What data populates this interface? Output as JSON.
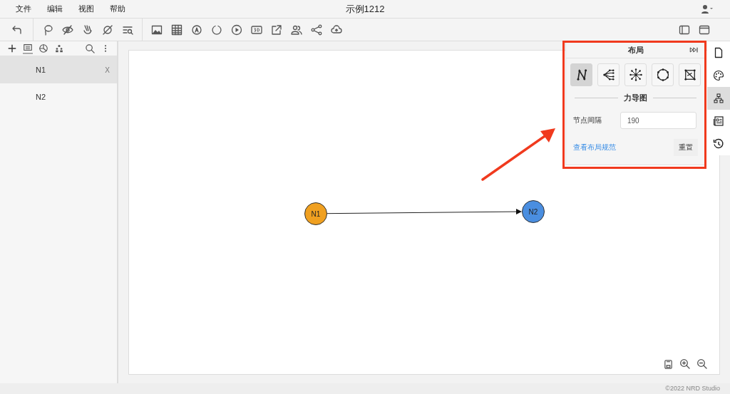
{
  "menu": [
    "文件",
    "编辑",
    "视图",
    "帮助"
  ],
  "window": {
    "title": "示例1212"
  },
  "sidebar_tabs": [
    {
      "selected": false
    },
    {
      "selected": true
    },
    {
      "selected": false
    },
    {
      "selected": false
    }
  ],
  "nodes_list": [
    {
      "label": "N1",
      "selected": true,
      "close": "X"
    },
    {
      "label": "N2",
      "selected": false
    }
  ],
  "graph": {
    "nodes": [
      {
        "label": "N1",
        "color": "#f0a020"
      },
      {
        "label": "N2",
        "color": "#4a8ee0"
      }
    ]
  },
  "layout_panel": {
    "title": "布局",
    "layouts": [
      {
        "selected": true
      },
      {
        "selected": false
      },
      {
        "selected": false
      },
      {
        "selected": false
      },
      {
        "selected": false
      }
    ],
    "section": "力导图",
    "field_label": "节点间隔",
    "field_value": "190",
    "link": "查看布局规范",
    "reset": "重置"
  },
  "right_tabs": [
    {
      "selected": false
    },
    {
      "selected": false
    },
    {
      "selected": true
    },
    {
      "selected": false
    },
    {
      "selected": false
    }
  ],
  "footer": "©2022 NRD Studio"
}
